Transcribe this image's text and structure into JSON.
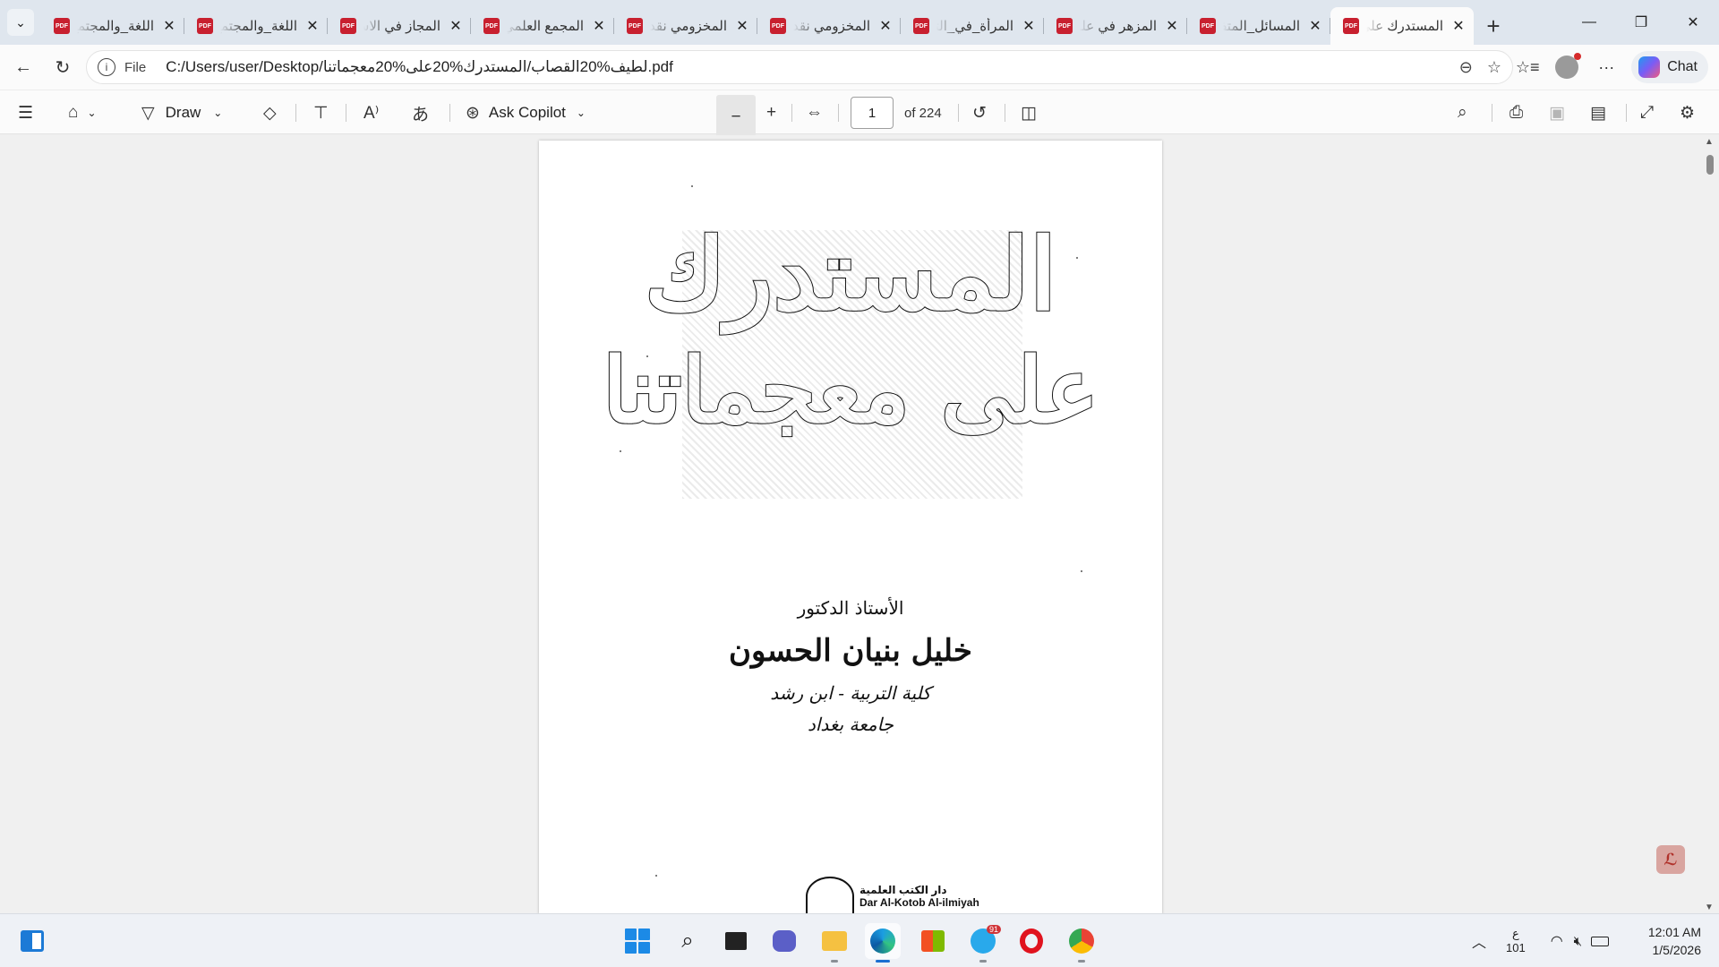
{
  "browser": {
    "tabs": [
      {
        "title": "اللغة_والمجتمع"
      },
      {
        "title": "اللغة_والمجتمع"
      },
      {
        "title": "المجاز في الاستعمال"
      },
      {
        "title": "المجمع العلمي"
      },
      {
        "title": "المخزومي نقد"
      },
      {
        "title": "المخزومي نقد"
      },
      {
        "title": "المرأة_في_التراث"
      },
      {
        "title": "المزهر في علوم"
      },
      {
        "title": "المسائل_المتفرقة"
      },
      {
        "title": "المستدرك على"
      }
    ],
    "active_tab": 9,
    "address": {
      "scheme_label": "File",
      "url": "C:/Users/user/Desktop/لطيف%20القصاب/المستدرك%20على%20معجماتنا.pdf"
    },
    "chat_label": "Chat",
    "icons": {
      "tab_menu": "chevron-down-icon",
      "new_tab": "plus-icon",
      "minimize": "minimize-icon",
      "restore": "restore-icon",
      "close": "close-icon"
    }
  },
  "pdf_toolbar": {
    "draw_label": "Draw",
    "copilot_label": "Ask Copilot",
    "page_number": "1",
    "page_total": "of 224"
  },
  "document": {
    "title_line1": "المستدرك",
    "title_line2": "على معجماتنا",
    "author_prefix": "الأستاذ الدكتور",
    "author_name": "خليل بنيان الحسون",
    "affiliation1": "كلية التربية - ابن رشد",
    "affiliation2": "جامعة بغداد",
    "publisher_ar": "دار الكتب العلمية",
    "publisher_en": "Dar Al-Kotob Al-ilmiyah"
  },
  "taskbar": {
    "telegram_badge": "91",
    "tray_lang_top": "ع",
    "tray_lang_bottom": "101",
    "time": "12:01 AM",
    "date": "1/5/2026"
  }
}
